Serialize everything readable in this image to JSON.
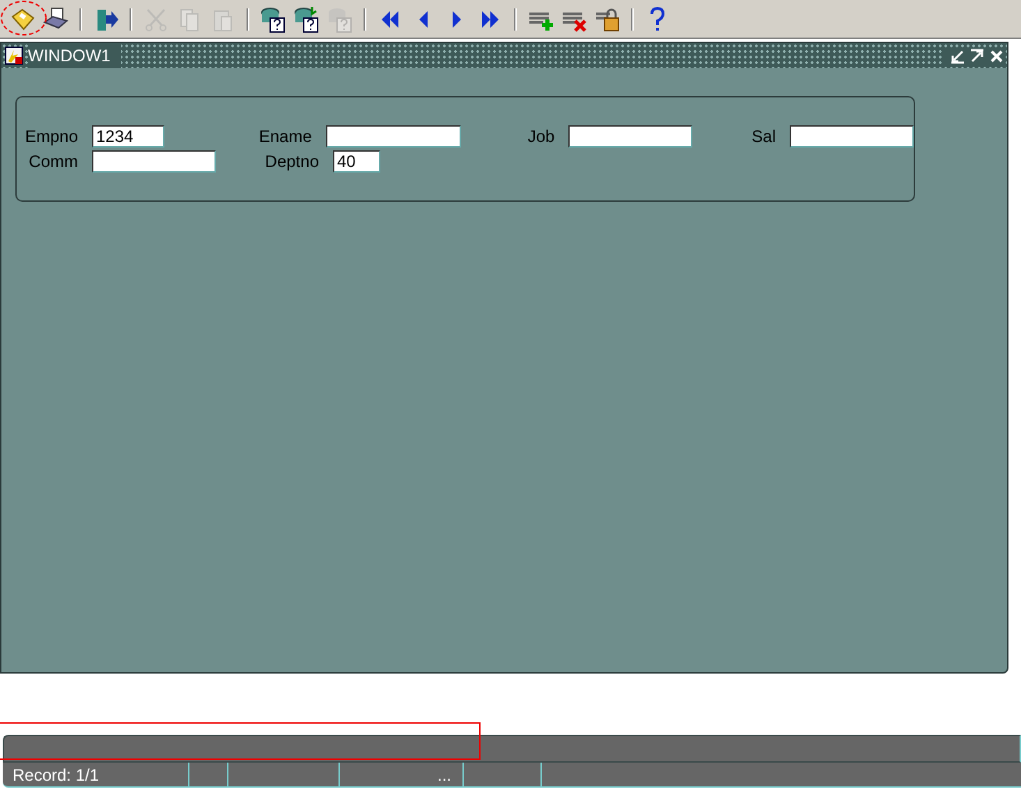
{
  "toolbar": {
    "buttons": [
      {
        "kind": "save",
        "disabled": false
      },
      {
        "kind": "print",
        "disabled": false
      },
      {
        "kind": "sep"
      },
      {
        "kind": "exit",
        "disabled": false
      },
      {
        "kind": "sep"
      },
      {
        "kind": "cut",
        "disabled": true
      },
      {
        "kind": "copy",
        "disabled": true
      },
      {
        "kind": "paste",
        "disabled": true
      },
      {
        "kind": "sep"
      },
      {
        "kind": "enter-query",
        "disabled": false
      },
      {
        "kind": "execute-query",
        "disabled": false
      },
      {
        "kind": "cancel-query",
        "disabled": true
      },
      {
        "kind": "sep"
      },
      {
        "kind": "first",
        "disabled": false
      },
      {
        "kind": "prev",
        "disabled": false
      },
      {
        "kind": "next",
        "disabled": false
      },
      {
        "kind": "last",
        "disabled": false
      },
      {
        "kind": "sep"
      },
      {
        "kind": "insert",
        "disabled": false
      },
      {
        "kind": "delete",
        "disabled": false
      },
      {
        "kind": "lock",
        "disabled": false
      },
      {
        "kind": "sep"
      },
      {
        "kind": "help",
        "disabled": false
      }
    ]
  },
  "window": {
    "title": "WINDOW1",
    "fields": [
      {
        "label": "Empno",
        "value": "1234"
      },
      {
        "label": "Ename"
      },
      {
        "label": "Job"
      },
      {
        "label": "Sal"
      },
      {
        "label": "Comm"
      },
      {
        "label": "Deptno",
        "value": "40"
      }
    ]
  },
  "status_bar": {
    "record": "Record: 1/1",
    "cells": [
      "",
      "",
      "...",
      "",
      ""
    ]
  }
}
